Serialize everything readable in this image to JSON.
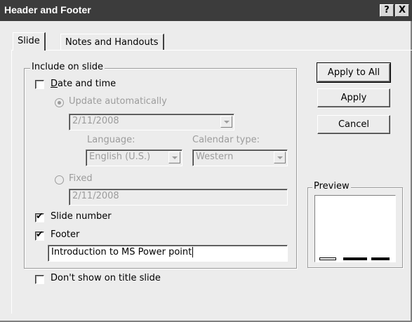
{
  "window": {
    "title": "Header and Footer",
    "help_button": "?",
    "close_button": "X"
  },
  "tabs": [
    {
      "label": "Slide",
      "active": true
    },
    {
      "label": "Notes and Handouts",
      "active": false
    }
  ],
  "include_group": {
    "legend": "Include on slide",
    "date_time": {
      "label": "Date and time",
      "checked": false
    },
    "update_auto": {
      "label": "Update automatically",
      "selected": true,
      "enabled": false
    },
    "date_select_value": "2/11/2008",
    "language": {
      "label": "Language:",
      "value": "English (U.S.)"
    },
    "calendar": {
      "label": "Calendar type:",
      "value": "Western"
    },
    "fixed": {
      "label": "Fixed",
      "selected": false,
      "enabled": false
    },
    "fixed_value": "2/11/2008",
    "slide_number": {
      "label": "Slide number",
      "checked": true
    },
    "footer": {
      "label": "Footer",
      "checked": true
    },
    "footer_value": "Introduction to MS Power point"
  },
  "dont_show": {
    "label": "Don't show on title slide",
    "checked": false
  },
  "buttons": {
    "apply_to_all": "Apply to All",
    "apply": "Apply",
    "cancel": "Cancel"
  },
  "preview": {
    "legend": "Preview"
  }
}
